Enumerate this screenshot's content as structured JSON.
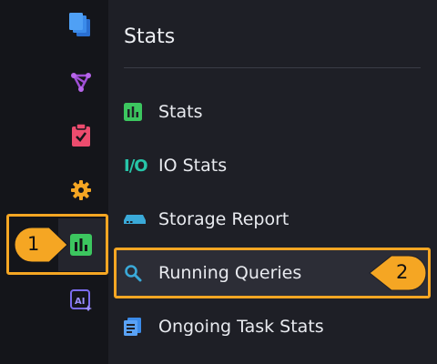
{
  "rail": {
    "items": [
      {
        "icon": "documents-icon",
        "color": "#3b8bea"
      },
      {
        "icon": "graph-nodes-icon",
        "color": "#a04fd6"
      },
      {
        "icon": "clipboard-check-icon",
        "color": "#ec4c6e"
      },
      {
        "icon": "gear-icon",
        "color": "#f5a623"
      },
      {
        "icon": "bar-chart-icon",
        "color": "#3cc65f",
        "active": true
      },
      {
        "icon": "ai-icon",
        "color": "#7b6cf0"
      }
    ]
  },
  "menu": {
    "title": "Stats",
    "items": [
      {
        "label": "Stats",
        "icon": "bar-chart-icon",
        "color": "#3cc65f"
      },
      {
        "label": "IO Stats",
        "icon": "io-icon",
        "glyph": "I/O",
        "color": "#27c4a8"
      },
      {
        "label": "Storage Report",
        "icon": "storage-drive-icon",
        "color": "#3aa9d8"
      },
      {
        "label": "Running Queries",
        "icon": "search-query-icon",
        "color": "#3aa9d8",
        "active": true
      },
      {
        "label": "Ongoing Task Stats",
        "icon": "task-list-icon",
        "color": "#3b8bea"
      }
    ]
  },
  "callouts": {
    "one": "1",
    "two": "2",
    "color": "#f5a623"
  }
}
